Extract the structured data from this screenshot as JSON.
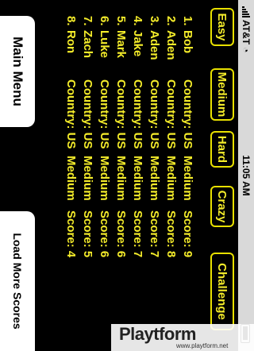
{
  "status_bar": {
    "carrier": "AT&T",
    "time": "11:05 AM"
  },
  "difficulty_tabs": [
    "Easy",
    "Medium",
    "Hard",
    "Crazy",
    "Challenge"
  ],
  "scores": [
    {
      "rank": "1.",
      "name": "Bob",
      "country": "Country: US",
      "difficulty": "Medium",
      "score": "Score: 9"
    },
    {
      "rank": "2.",
      "name": "Aden",
      "country": "Country: US",
      "difficulty": "Medium",
      "score": "Score: 8"
    },
    {
      "rank": "3.",
      "name": "Aden",
      "country": "Country: US",
      "difficulty": "Medium",
      "score": "Score: 7"
    },
    {
      "rank": "4.",
      "name": "Jake",
      "country": "Country: US",
      "difficulty": "Medium",
      "score": "Score: 7"
    },
    {
      "rank": "5.",
      "name": "Mark",
      "country": "Country: US",
      "difficulty": "Medium",
      "score": "Score: 6"
    },
    {
      "rank": "6.",
      "name": "Luke",
      "country": "Country: US",
      "difficulty": "Medium",
      "score": "Score: 6"
    },
    {
      "rank": "7.",
      "name": "Zach",
      "country": "Country: US",
      "difficulty": "Medium",
      "score": "Score: 5"
    },
    {
      "rank": "8.",
      "name": "Ron",
      "country": "Country: US",
      "difficulty": "Medium",
      "score": "Score: 4"
    }
  ],
  "buttons": {
    "main_menu": "Main Menu",
    "load_more": "Load More Scores"
  },
  "watermark": {
    "brand": "Playtform",
    "url": "www.playtform.net"
  },
  "colors": {
    "accent_yellow": "#f4ec2a",
    "background": "#000000"
  }
}
